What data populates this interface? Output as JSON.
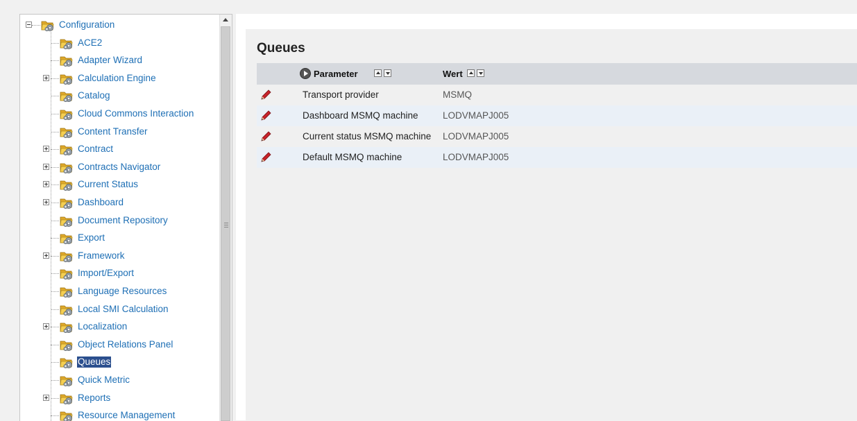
{
  "tree": {
    "items": [
      {
        "label": "Configuration",
        "expander": "minus"
      },
      {
        "label": "ACE2",
        "expander": ""
      },
      {
        "label": "Adapter Wizard",
        "expander": ""
      },
      {
        "label": "Calculation Engine",
        "expander": "plus"
      },
      {
        "label": "Catalog",
        "expander": ""
      },
      {
        "label": "Cloud Commons Interaction",
        "expander": ""
      },
      {
        "label": "Content Transfer",
        "expander": ""
      },
      {
        "label": "Contract",
        "expander": "plus"
      },
      {
        "label": "Contracts Navigator",
        "expander": "plus"
      },
      {
        "label": "Current Status",
        "expander": "plus"
      },
      {
        "label": "Dashboard",
        "expander": "plus"
      },
      {
        "label": "Document Repository",
        "expander": ""
      },
      {
        "label": "Export",
        "expander": ""
      },
      {
        "label": "Framework",
        "expander": "plus"
      },
      {
        "label": "Import/Export",
        "expander": ""
      },
      {
        "label": "Language Resources",
        "expander": ""
      },
      {
        "label": "Local SMI Calculation",
        "expander": ""
      },
      {
        "label": "Localization",
        "expander": "plus"
      },
      {
        "label": "Object Relations Panel",
        "expander": ""
      },
      {
        "label": "Queues",
        "expander": "",
        "selected": true
      },
      {
        "label": "Quick Metric",
        "expander": ""
      },
      {
        "label": "Reports",
        "expander": "plus"
      },
      {
        "label": "Resource Management",
        "expander": ""
      }
    ],
    "folder_icon": "gear-folder-icon",
    "colors": {
      "link": "#1e6fb5",
      "selected_bg": "#2b4f8e"
    }
  },
  "main": {
    "title": "Queues",
    "table": {
      "headers": {
        "parameter": "Parameter",
        "value": "Wert"
      },
      "rows": [
        {
          "parameter": "Transport provider",
          "value": "MSMQ"
        },
        {
          "parameter": "Dashboard MSMQ machine",
          "value": "LODVMAPJ005"
        },
        {
          "parameter": "Current status MSMQ machine",
          "value": "LODVMAPJ005"
        },
        {
          "parameter": "Default MSMQ machine",
          "value": "LODVMAPJ005"
        }
      ],
      "row_icon": "pencil-edit-icon"
    }
  }
}
